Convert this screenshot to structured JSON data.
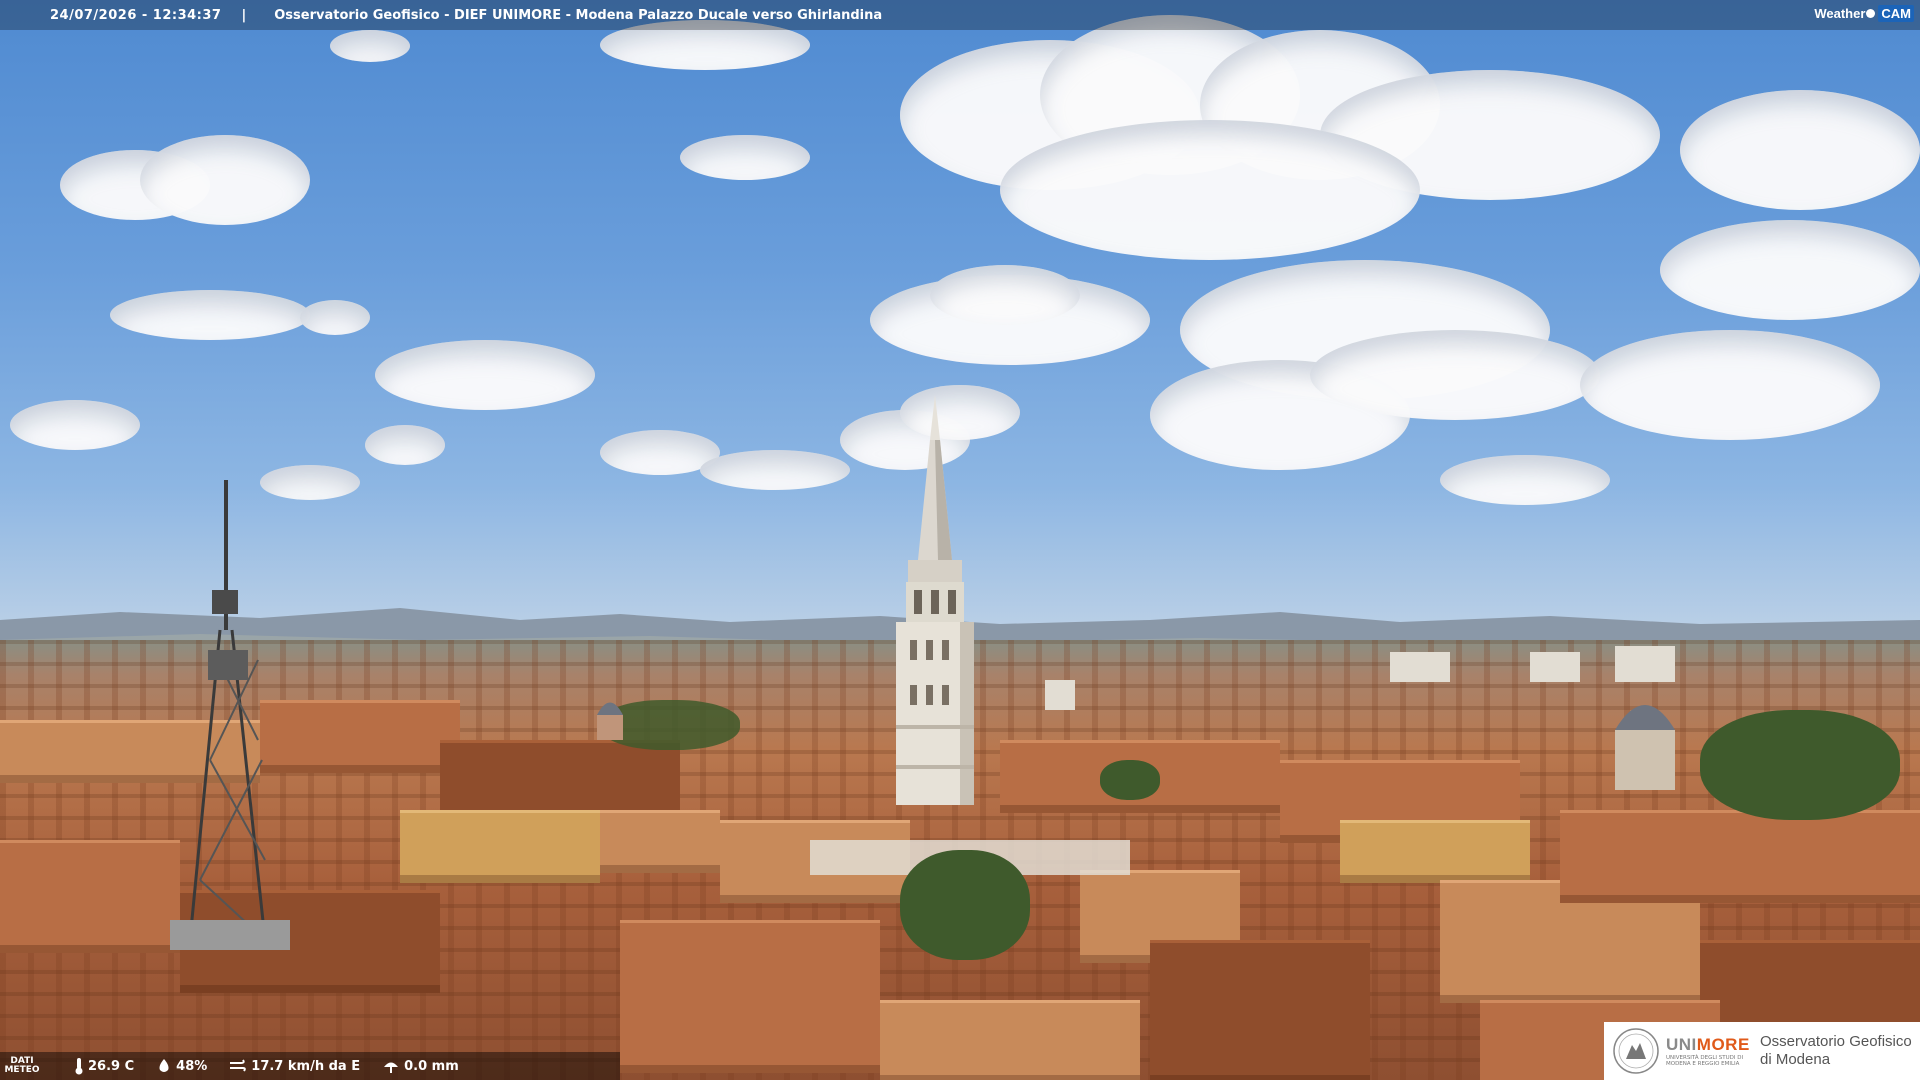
{
  "header": {
    "timestamp": "24/07/2026 - 12:34:37",
    "separator": "|",
    "title": "Osservatorio Geofisico - DIEF UNIMORE - Modena Palazzo Ducale verso Ghirlandina"
  },
  "brand": {
    "weather_label": "Weather",
    "cam_label": "CAM"
  },
  "meteo": {
    "label_line1": "DATI",
    "label_line2": "METEO",
    "temperature": "26.9 C",
    "humidity": "48%",
    "wind": "17.7 km/h da E",
    "rain": "0.0 mm",
    "icons": [
      "thermometer-icon",
      "humidity-drop-icon",
      "wind-icon",
      "rain-icon"
    ]
  },
  "logo": {
    "uni_prefix": "UNI",
    "uni_suffix": "MORE",
    "uni_subtitle": "UNIVERSITÀ DEGLI STUDI DI MODENA E REGGIO EMILIA",
    "observatory_line1": "Osservatorio Geofisico",
    "observatory_line2": "di Modena",
    "accent_color": "#e05a1a"
  }
}
